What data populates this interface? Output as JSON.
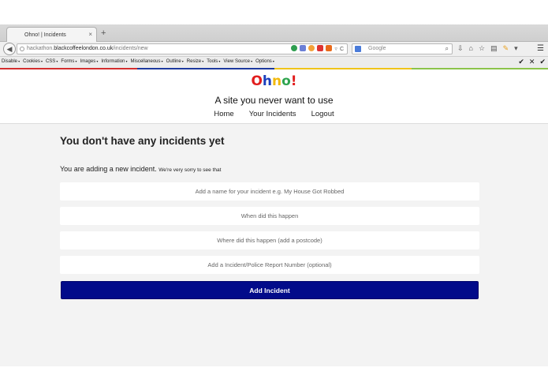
{
  "browser": {
    "tab_title": "Ohno! | Incidents",
    "tab_close": "×",
    "new_tab": "+",
    "back": "◀",
    "url_prefix": "hackathon.",
    "url_host": "blackcoffeelondon.co.uk",
    "url_path": "/incidents/new",
    "search_placeholder": "Google",
    "search_icon": "magnifier-icon",
    "reload": "C",
    "menu": "☰"
  },
  "devbar": {
    "items": [
      "Disable",
      "Cookies",
      "CSS",
      "Forms",
      "Images",
      "Information",
      "Miscellaneous",
      "Outline",
      "Resize",
      "Tools",
      "View Source",
      "Options"
    ],
    "right": [
      "✔",
      "✕",
      "✔"
    ]
  },
  "site": {
    "logo": [
      "O",
      "h",
      "n",
      "o",
      "!"
    ],
    "logo_colors": [
      "#e11d1d",
      "#1b3fbd",
      "#f2b90c",
      "#2fa44f",
      "#e11d1d"
    ],
    "tagline": "A site you never want to use",
    "nav": {
      "home": "Home",
      "incidents": "Your Incidents",
      "logout": "Logout"
    }
  },
  "main": {
    "empty_title": "You don't have any incidents yet",
    "adding": "You are adding a new incident.",
    "adding_sub": "We're very sorry to see that",
    "fields": {
      "name": "Add a name for your incident e.g. My House Got Robbed",
      "when": "When did this happen",
      "where": "Where did this happen (add a postcode)",
      "report": "Add a Incident/Police Report Number (optional)"
    },
    "submit": "Add Incident"
  },
  "colors": {
    "accent": "#020b8a",
    "stripe": [
      "#d32f2f",
      "#1e3a9e",
      "#f0c419",
      "#8bc34a"
    ]
  }
}
